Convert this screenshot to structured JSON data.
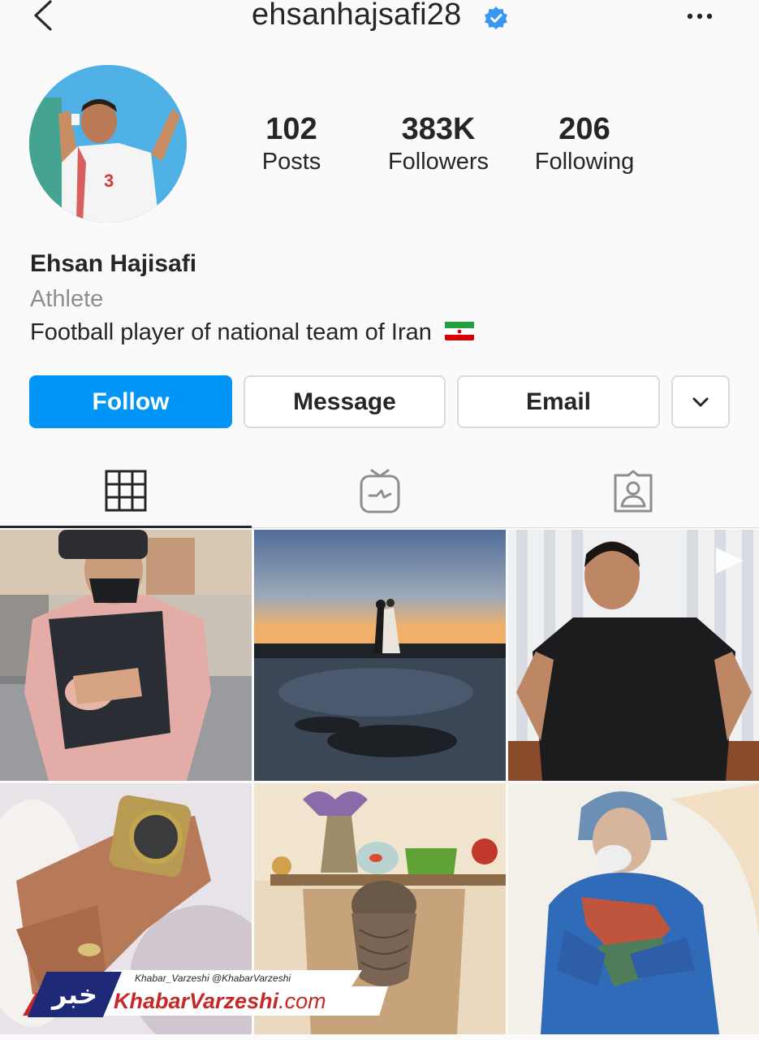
{
  "header": {
    "username": "ehsanhajsafi28",
    "verified": true,
    "icons": [
      "back-chevron-icon",
      "verified-badge-icon",
      "more-dots-icon"
    ]
  },
  "stats": [
    {
      "value": "102",
      "label": "Posts"
    },
    {
      "value": "383K",
      "label": "Followers"
    },
    {
      "value": "206",
      "label": "Following"
    }
  ],
  "profile": {
    "full_name": "Ehsan Hajisafi",
    "category": "Athlete",
    "bio": "Football player of national team of Iran",
    "flag_icon": "iran-flag-icon"
  },
  "actions": {
    "follow": "Follow",
    "message": "Message",
    "email": "Email",
    "more_icon": "chevron-down-icon"
  },
  "tabs": {
    "icons": [
      "grid-icon",
      "igtv-icon",
      "tagged-icon"
    ],
    "active": 0
  },
  "posts": [
    {
      "kind": "photo",
      "subject": "man-with-baby-carrier"
    },
    {
      "kind": "photo",
      "subject": "wedding-sunset-silhouette"
    },
    {
      "kind": "video",
      "subject": "man-black-shirt-portrait"
    },
    {
      "kind": "photo",
      "subject": "hand-with-watch-and-ring"
    },
    {
      "kind": "photo",
      "subject": "persian-nowruz-painting"
    },
    {
      "kind": "photo",
      "subject": "nurse-holding-iran-map"
    }
  ],
  "watermark": {
    "social": "Khabar_Varzeshi  @KhabarVarzeshi",
    "site_name": "KhabarVarzeshi",
    "site_domain": ".com",
    "logo_text": "خبر"
  },
  "colors": {
    "follow_blue": "#0095f6",
    "verified_blue": "#3897f0",
    "text": "#262626",
    "muted": "#8e8e8e",
    "border": "#dbdbdb",
    "watermark_red": "#c62828",
    "watermark_navy": "#1e2a78"
  }
}
